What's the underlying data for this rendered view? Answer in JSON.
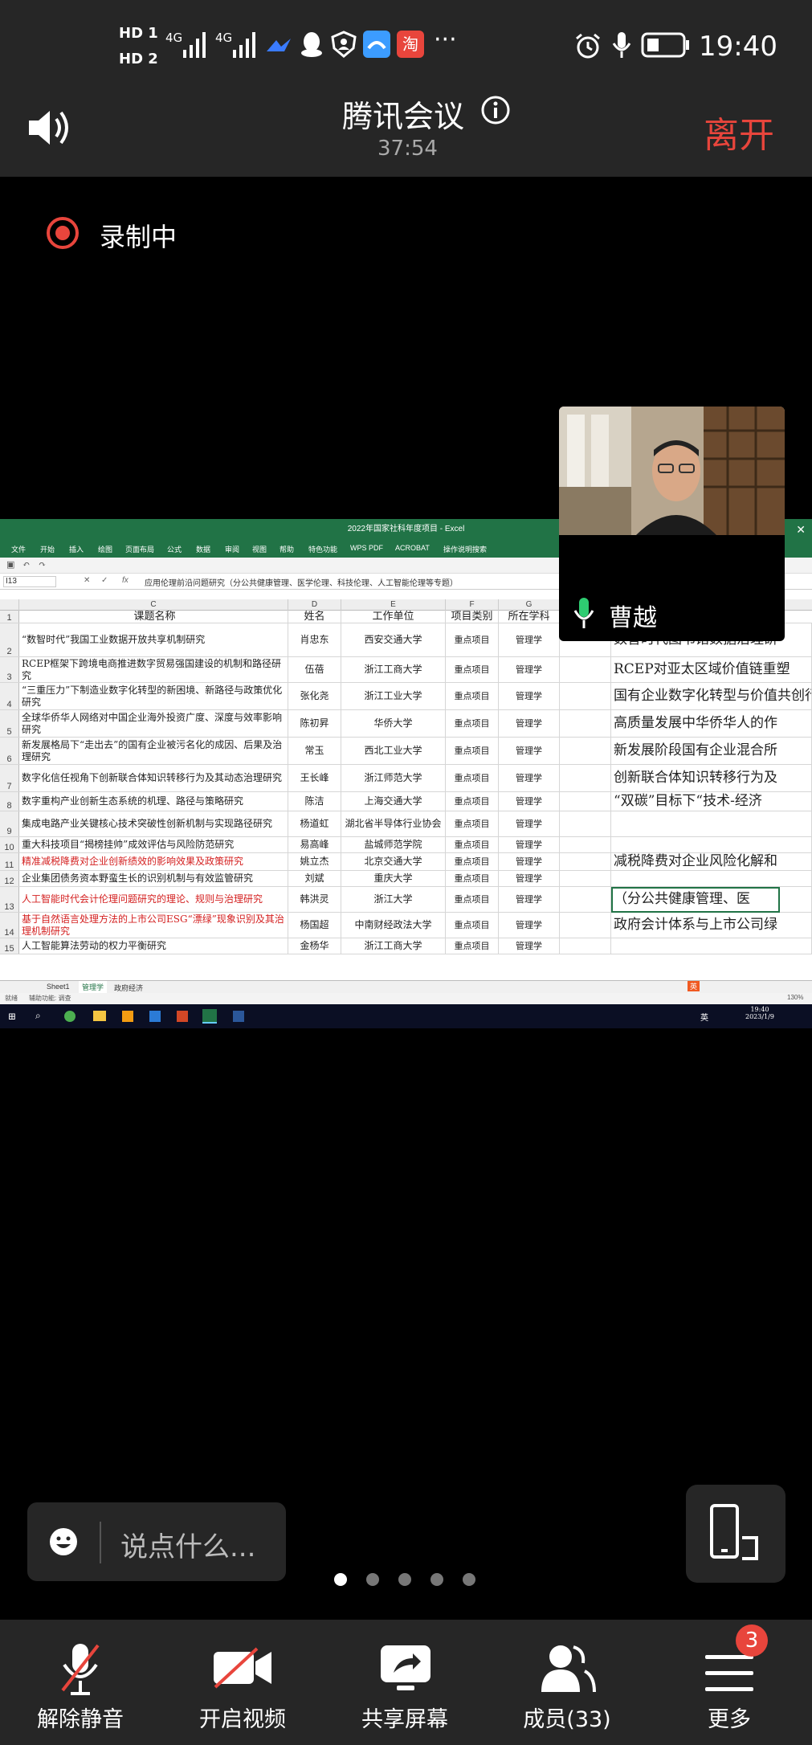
{
  "status_bar": {
    "hd1": "HD",
    "hd1_num": "1",
    "hd2": "HD",
    "hd2_num": "2",
    "net1": "4G",
    "net2": "4G",
    "more": "···",
    "time": "19:40"
  },
  "meeting": {
    "title": "腾讯会议",
    "duration": "37:54",
    "leave_label": "离开",
    "recording_label": "录制中"
  },
  "participant": {
    "name": "曹越"
  },
  "excel": {
    "window_title": "2022年国家社科年度项目 - Excel",
    "menu": [
      "文件",
      "开始",
      "插入",
      "绘图",
      "页面布局",
      "公式",
      "数据",
      "审阅",
      "视图",
      "帮助",
      "特色功能",
      "WPS PDF",
      "ACROBAT",
      "操作说明搜索"
    ],
    "name_box": "I13",
    "formula": "应用伦理前沿问题研究（分公共健康管理、医学伦理、科技伦理、人工智能伦理等专题）",
    "columns": [
      "C",
      "D",
      "E",
      "F",
      "G"
    ],
    "header_row": {
      "num": "1",
      "c": "课题名称",
      "d": "姓名",
      "e": "工作单位",
      "f": "项目类别",
      "g": "所在学科"
    },
    "rows": [
      {
        "num": "2",
        "c": "“数智时代”我国工业数据开放共享机制研究",
        "d": "肖忠东",
        "e": "西安交通大学",
        "f": "重点项目",
        "g": "管理学",
        "i": "数智时代图书馆数据治理研",
        "red": false
      },
      {
        "num": "3",
        "c": "RCEP框架下跨境电商推进数字贸易强国建设的机制和路径研究",
        "d": "伍蓓",
        "e": "浙江工商大学",
        "f": "重点项目",
        "g": "管理学",
        "i": "RCEP对亚太区域价值链重塑",
        "red": false
      },
      {
        "num": "4",
        "c": "“三重压力”下制造业数字化转型的新困境、新路径与政策优化研究",
        "d": "张化尧",
        "e": "浙江工业大学",
        "f": "重点项目",
        "g": "管理学",
        "i": "国有企业数字化转型与价值共创行为研究",
        "red": false
      },
      {
        "num": "5",
        "c": "全球华侨华人网络对中国企业海外投资广度、深度与效率影响研究",
        "d": "陈初昇",
        "e": "华侨大学",
        "f": "重点项目",
        "g": "管理学",
        "i": "高质量发展中华侨华人的作",
        "red": false
      },
      {
        "num": "6",
        "c": "新发展格局下“走出去”的国有企业被污名化的成因、后果及治理研究",
        "d": "常玉",
        "e": "西北工业大学",
        "f": "重点项目",
        "g": "管理学",
        "i": "新发展阶段国有企业混合所",
        "red": false
      },
      {
        "num": "7",
        "c": "数字化信任视角下创新联合体知识转移行为及其动态治理研究",
        "d": "王长峰",
        "e": "浙江师范大学",
        "f": "重点项目",
        "g": "管理学",
        "i": "创新联合体知识转移行为及",
        "red": false
      },
      {
        "num": "8",
        "c": "数字重构产业创新生态系统的机理、路径与策略研究",
        "d": "陈洁",
        "e": "上海交通大学",
        "f": "重点项目",
        "g": "管理学",
        "i": "“双碳”目标下“技术-经济",
        "red": false
      },
      {
        "num": "9",
        "c": "集成电路产业关键核心技术突破性创新机制与实现路径研究",
        "d": "杨道虹",
        "e": "湖北省半导体行业协会",
        "f": "重点项目",
        "g": "管理学",
        "i": "",
        "red": false
      },
      {
        "num": "10",
        "c": "重大科技项目“揭榜挂帅”成效评估与风险防范研究",
        "d": "易高峰",
        "e": "盐城师范学院",
        "f": "重点项目",
        "g": "管理学",
        "i": "",
        "red": false
      },
      {
        "num": "11",
        "c": "精准减税降费对企业创新绩效的影响效果及政策研究",
        "d": "姚立杰",
        "e": "北京交通大学",
        "f": "重点项目",
        "g": "管理学",
        "i": "减税降费对企业风险化解和",
        "red": true
      },
      {
        "num": "12",
        "c": "企业集团债务资本野蛮生长的识别机制与有效监管研究",
        "d": "刘斌",
        "e": "重庆大学",
        "f": "重点项目",
        "g": "管理学",
        "i": "",
        "red": false
      },
      {
        "num": "13",
        "c": "人工智能时代会计伦理问题研究的理论、规则与治理研究",
        "d": "韩洪灵",
        "e": "浙江大学",
        "f": "重点项目",
        "g": "管理学",
        "i": "（分公共健康管理、医",
        "red": true
      },
      {
        "num": "14",
        "c": "基于自然语言处理方法的上市公司ESG“漂绿”现象识别及其治理机制研究",
        "d": "杨国超",
        "e": "中南财经政法大学",
        "f": "重点项目",
        "g": "管理学",
        "i": "政府会计体系与上市公司绿",
        "red": true
      },
      {
        "num": "15",
        "c": "人工智能算法劳动的权力平衡研究",
        "d": "金杨华",
        "e": "浙江工商大学",
        "f": "重点项目",
        "g": "管理学",
        "i": "",
        "red": false
      }
    ],
    "sheet_tabs": [
      "Sheet1",
      "管理学",
      "政府经济"
    ],
    "status_left": "就绪",
    "status_access": "辅助功能: 调查",
    "ime_label": "英",
    "taskbar_time": "19:40",
    "taskbar_date": "2023/1/9",
    "taskbar_lang": "英",
    "zoom": "130%"
  },
  "chat": {
    "placeholder": "说点什么..."
  },
  "page_dots": {
    "count": 5,
    "active": 0
  },
  "toolbar": {
    "unmute": "解除静音",
    "video": "开启视频",
    "share": "共享屏幕",
    "members": "成员(33)",
    "more": "更多",
    "more_badge": "3"
  },
  "colors": {
    "accent_red": "#e8453c",
    "excel_green": "#217346",
    "mic_green": "#2ecc71"
  }
}
